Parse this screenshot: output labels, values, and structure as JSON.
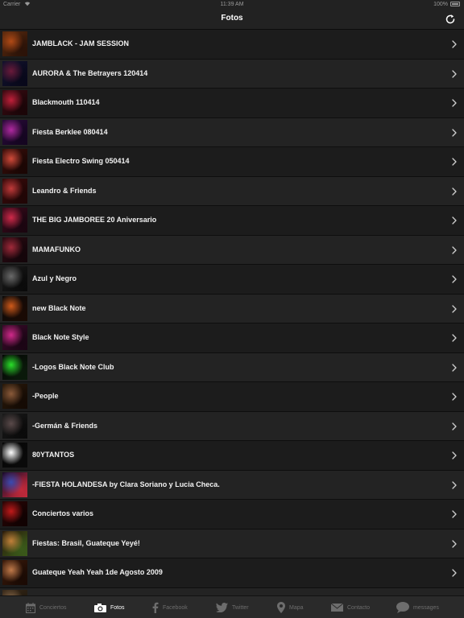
{
  "status_bar": {
    "carrier": "Carrier",
    "time": "11:39 AM",
    "battery": "100%"
  },
  "nav": {
    "title": "Fotos"
  },
  "albums": [
    {
      "label": "JAMBLACK - JAM SESSION",
      "thumb_colors": [
        "#5a2a0e",
        "#b04a16",
        "#2a1208"
      ]
    },
    {
      "label": "AURORA & The Betrayers 120414",
      "thumb_colors": [
        "#12122e",
        "#6a1a3a",
        "#08081a"
      ]
    },
    {
      "label": "Blackmouth 110414",
      "thumb_colors": [
        "#3a0a12",
        "#c0203a",
        "#1a0508"
      ]
    },
    {
      "label": "Fiesta Berklee 080414",
      "thumb_colors": [
        "#2a0a3a",
        "#b02aa0",
        "#140520"
      ]
    },
    {
      "label": "Fiesta Electro Swing 050414",
      "thumb_colors": [
        "#3a0e0a",
        "#d04a3a",
        "#1a0604"
      ]
    },
    {
      "label": "Leandro & Friends",
      "thumb_colors": [
        "#3a0a0a",
        "#c03a3a",
        "#200606"
      ]
    },
    {
      "label": "THE BIG JAMBOREE 20 Aniversario",
      "thumb_colors": [
        "#3a0a1a",
        "#d02a4a",
        "#1a0510"
      ]
    },
    {
      "label": "MAMAFUNKO",
      "thumb_colors": [
        "#2a0a12",
        "#a02a3a",
        "#14050a"
      ]
    },
    {
      "label": "Azul y Negro",
      "thumb_colors": [
        "#1a1a1a",
        "#6a6a6a",
        "#0a0a0a"
      ]
    },
    {
      "label": "new Black Note",
      "thumb_colors": [
        "#0a0a0a",
        "#d05a1a",
        "#1a0a04"
      ]
    },
    {
      "label": "Black Note Style",
      "thumb_colors": [
        "#3a0a2a",
        "#d02a8a",
        "#1a0514"
      ]
    },
    {
      "label": "-Logos Black Note Club",
      "thumb_colors": [
        "#050505",
        "#2adf2a",
        "#0a1a0a"
      ]
    },
    {
      "label": "-People",
      "thumb_colors": [
        "#2a1a0a",
        "#8a5a3a",
        "#140a04"
      ]
    },
    {
      "label": "-Germán & Friends",
      "thumb_colors": [
        "#1a1a1a",
        "#5a4a4a",
        "#0a0a0a"
      ]
    },
    {
      "label": "80YTANTOS",
      "thumb_colors": [
        "#050505",
        "#ffffff",
        "#0a0a0a"
      ]
    },
    {
      "label": "-FIESTA HOLANDESA by Clara Soriano y Lucia Checa.",
      "thumb_colors": [
        "#1a0a2a",
        "#3a4ab0",
        "#c02a3a"
      ]
    },
    {
      "label": "Conciertos varios",
      "thumb_colors": [
        "#2a0505",
        "#c01a1a",
        "#100202"
      ]
    },
    {
      "label": "Fiestas: Brasil, Guateque Yeyé!",
      "thumb_colors": [
        "#2a1a0a",
        "#c0803a",
        "#3a5a1a"
      ]
    },
    {
      "label": "Guateque Yeah Yeah 1de Agosto 2009",
      "thumb_colors": [
        "#3a1a0a",
        "#c07a4a",
        "#1a0a04"
      ]
    },
    {
      "label": "",
      "thumb_colors": [
        "#3a2a1a",
        "#8a6a4a",
        "#1a140a"
      ]
    }
  ],
  "tabs": [
    {
      "label": "Conciertos",
      "icon": "calendar-icon",
      "active": false
    },
    {
      "label": "Fotos",
      "icon": "camera-icon",
      "active": true
    },
    {
      "label": "Facebook",
      "icon": "facebook-icon",
      "active": false
    },
    {
      "label": "Twitter",
      "icon": "twitter-icon",
      "active": false
    },
    {
      "label": "Mapa",
      "icon": "map-pin-icon",
      "active": false
    },
    {
      "label": "Contacto",
      "icon": "envelope-icon",
      "active": false
    },
    {
      "label": "messages",
      "icon": "chat-bubble-icon",
      "active": false
    }
  ],
  "colors": {
    "background": "#141414",
    "bar": "#222222",
    "tab_inactive": "#6d6d6d",
    "tab_active": "#ffffff"
  }
}
